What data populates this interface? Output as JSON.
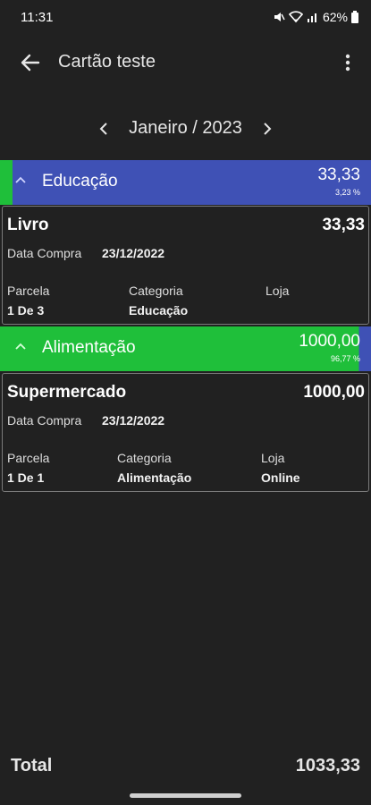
{
  "status_bar": {
    "time": "11:31",
    "battery": "62%"
  },
  "app_bar": {
    "title": "Cartão teste"
  },
  "month_nav": {
    "label": "Janeiro / 2023"
  },
  "groups": [
    {
      "category": "Educação",
      "total": "33,33",
      "percent": "3,23 %",
      "percent_value": 3.23,
      "color": "#3f51b5",
      "purchase": {
        "title": "Livro",
        "value": "33,33",
        "date_label": "Data Compra",
        "date": "23/12/2022",
        "installment_label": "Parcela",
        "installment": "1 De 3",
        "category_label": "Categoria",
        "category": "Educação",
        "store_label": "Loja",
        "store": ""
      }
    },
    {
      "category": "Alimentação",
      "total": "1000,00",
      "percent": "96,77 %",
      "percent_value": 96.77,
      "color": "#1fbf3a",
      "purchase": {
        "title": "Supermercado",
        "value": "1000,00",
        "date_label": "Data Compra",
        "date": "23/12/2022",
        "installment_label": "Parcela",
        "installment": "1 De 1",
        "category_label": "Categoria",
        "category": "Alimentação",
        "store_label": "Loja",
        "store": "Online"
      }
    }
  ],
  "footer": {
    "total_label": "Total",
    "total_value": "1033,33"
  },
  "colors": {
    "background": "#212121",
    "progress_green": "#1fbf3a",
    "progress_blue": "#3f51b5"
  }
}
